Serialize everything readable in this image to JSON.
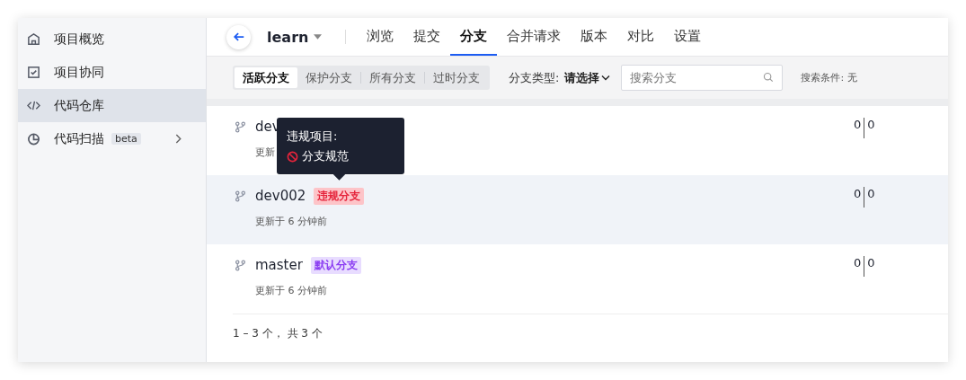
{
  "sidebar": {
    "items": [
      {
        "label": "项目概览",
        "selected": false
      },
      {
        "label": "项目协同",
        "selected": false
      },
      {
        "label": "代码仓库",
        "selected": true
      },
      {
        "label": "代码扫描",
        "selected": false,
        "badge": "beta",
        "expandable": true
      }
    ]
  },
  "header": {
    "repo": "learn",
    "tabs": [
      {
        "label": "浏览",
        "selected": false
      },
      {
        "label": "提交",
        "selected": false
      },
      {
        "label": "分支",
        "selected": true
      },
      {
        "label": "合并请求",
        "selected": false
      },
      {
        "label": "版本",
        "selected": false
      },
      {
        "label": "对比",
        "selected": false
      },
      {
        "label": "设置",
        "selected": false
      }
    ]
  },
  "filter": {
    "tabs": [
      {
        "label": "活跃分支",
        "selected": true
      },
      {
        "label": "保护分支",
        "selected": false
      },
      {
        "label": "所有分支",
        "selected": false
      },
      {
        "label": "过时分支",
        "selected": false
      }
    ],
    "type_label": "分支类型:",
    "type_value": "请选择",
    "search": {
      "placeholder": "搜索分支"
    },
    "conditions": "搜索条件: 无"
  },
  "branches": [
    {
      "name": "dev",
      "updated": "更新",
      "selected": false,
      "behind": "0",
      "ahead": "0"
    },
    {
      "name": "dev002",
      "updated": "更新于 6 分钟前",
      "selected": true,
      "behind": "0",
      "ahead": "0",
      "tag": {
        "text": "违规分支",
        "kind": "violation"
      }
    },
    {
      "name": "master",
      "updated": "更新于 6 分钟前",
      "selected": false,
      "behind": "0",
      "ahead": "0",
      "tag": {
        "text": "默认分支",
        "kind": "default"
      }
    }
  ],
  "tooltip": {
    "title": "违规项目:",
    "item": "分支规范"
  },
  "pagination": "1 – 3 个， 共 3 个"
}
